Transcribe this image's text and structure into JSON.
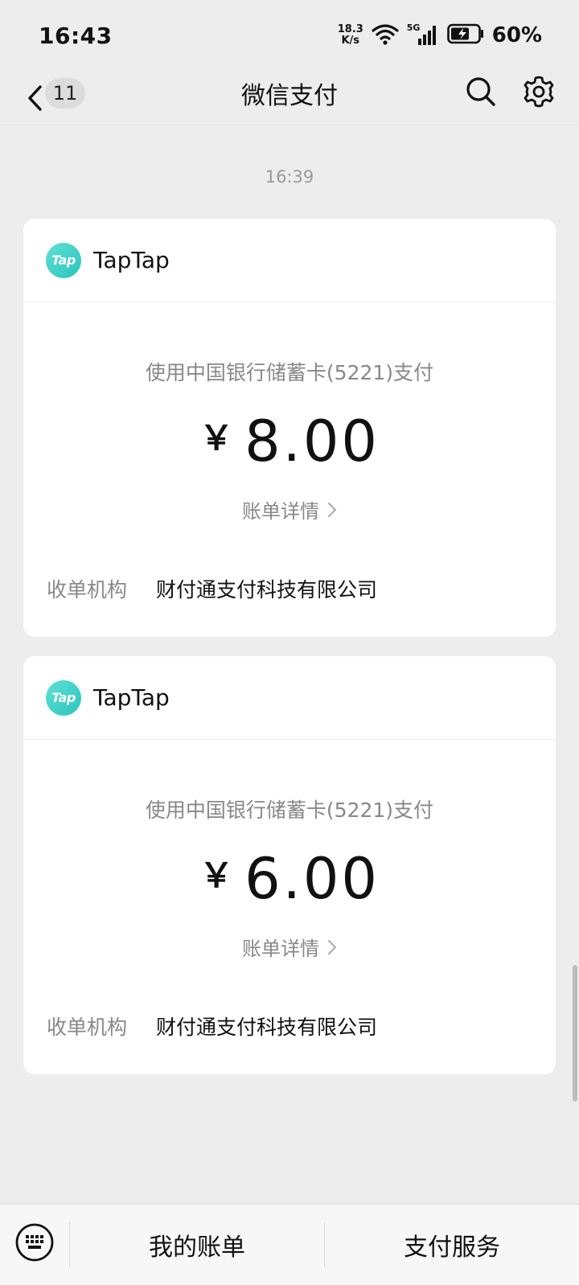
{
  "status_bar": {
    "time": "16:43",
    "net_speed_value": "18.3",
    "net_speed_unit": "K/s",
    "network_type": "5G",
    "battery_percent": "60%"
  },
  "nav": {
    "unread_count": "11",
    "title": "微信支付"
  },
  "chat": {
    "timestamp": "16:39"
  },
  "payments": [
    {
      "merchant": "TapTap",
      "logo_text": "Tap",
      "method": "使用中国银行储蓄卡(5221)支付",
      "currency_symbol": "￥",
      "amount": "8.00",
      "detail_link": "账单详情",
      "acquirer_label": "收单机构",
      "acquirer": "财付通支付科技有限公司"
    },
    {
      "merchant": "TapTap",
      "logo_text": "Tap",
      "method": "使用中国银行储蓄卡(5221)支付",
      "currency_symbol": "￥",
      "amount": "6.00",
      "detail_link": "账单详情",
      "acquirer_label": "收单机构",
      "acquirer": "财付通支付科技有限公司"
    }
  ],
  "bottom_bar": {
    "my_bills": "我的账单",
    "pay_services": "支付服务"
  },
  "colors": {
    "background": "#ededed",
    "card": "#ffffff",
    "secondary_text": "#888888",
    "logo_teal": "#2bc4c0"
  }
}
